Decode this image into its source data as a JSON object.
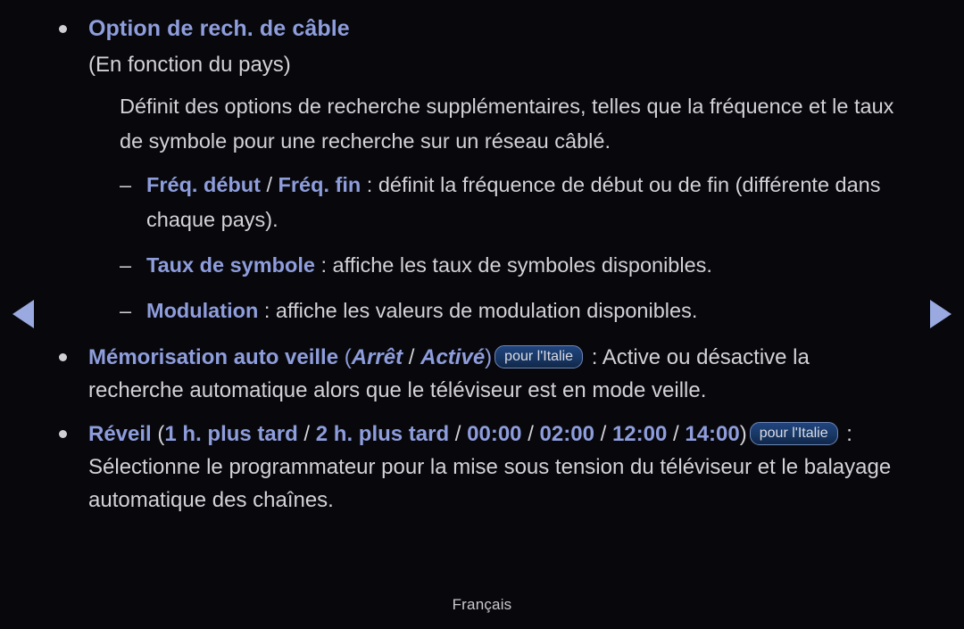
{
  "page": {
    "background_color": "#08080c",
    "accent_color": "#8e9ddc",
    "text_color": "#d2d2d7",
    "badge_border_color": "#6f86b8",
    "footer_label": "Français"
  },
  "nav": {
    "prev_icon": "triangle-left-icon",
    "next_icon": "triangle-right-icon"
  },
  "sections": [
    {
      "id": "option-rech-cable",
      "bullet_icon": "bullet-dot-icon",
      "heading": "Option de rech. de câble",
      "subnote": "(En fonction du pays)",
      "paragraph": "Définit des options de recherche supplémentaires, telles que la fréquence et le taux de symbole pour une recherche sur un réseau câblé.",
      "sub_items": [
        {
          "dash": "–",
          "term_1": "Fréq. début",
          "separator": " / ",
          "term_2": "Fréq. fin",
          "description": " : définit la fréquence de début ou de fin (différente dans chaque pays)."
        },
        {
          "dash": "–",
          "term_1": "Taux de symbole",
          "description": " : affiche les taux de symboles disponibles."
        },
        {
          "dash": "–",
          "term_1": "Modulation",
          "description": " : affiche les valeurs de modulation disponibles."
        }
      ]
    },
    {
      "id": "memorisation-auto-veille",
      "bullet_icon": "bullet-dot-icon",
      "title": "Mémorisation auto veille",
      "paren_open": " (",
      "option_1": "Arrêt",
      "option_sep": " / ",
      "option_2": "Activé",
      "paren_close": ")",
      "badge": "pour l'Italie",
      "description": " : Active ou désactive la recherche automatique alors que le téléviseur est en mode veille."
    },
    {
      "id": "reveil",
      "bullet_icon": "bullet-dot-icon",
      "title": "Réveil",
      "paren_open": " (",
      "options": [
        "1 h. plus tard",
        "2 h. plus tard",
        "00:00",
        "02:00",
        "12:00",
        "14:00"
      ],
      "option_sep": " / ",
      "paren_close": ")",
      "badge": "pour l'Italie",
      "description": " : Sélectionne le programmateur pour la mise sous tension du téléviseur et le balayage automatique des chaînes."
    }
  ]
}
